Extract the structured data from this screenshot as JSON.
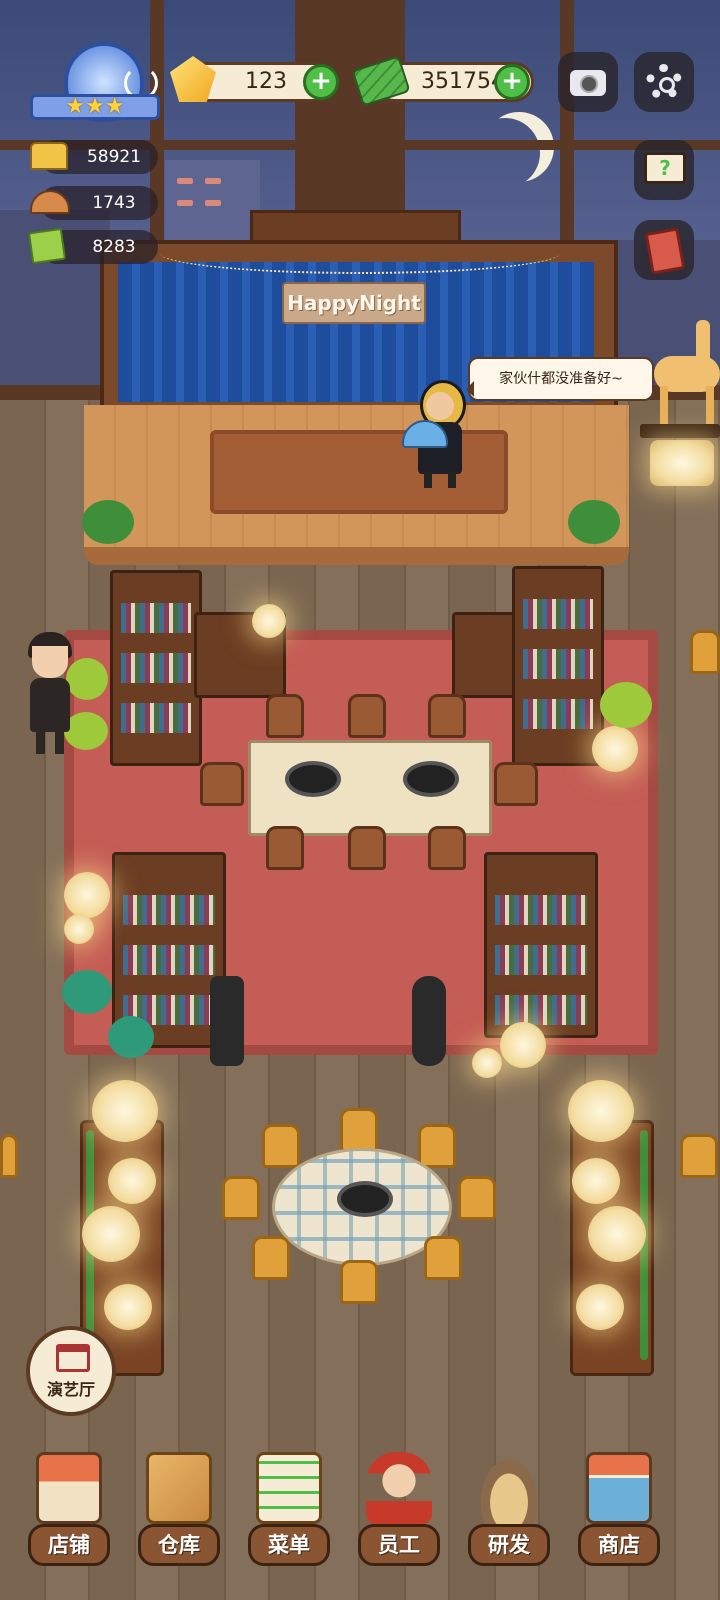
{
  "hud": {
    "gems": "123",
    "cash": "351754",
    "seats": "58921",
    "dishes": "1743",
    "recipes": "8283",
    "level_stars": "★★★"
  },
  "scene": {
    "stage_sign": "HappyNight",
    "speech_bubble": "家伙什都没准备好~",
    "theater_button_label": "演艺厅"
  },
  "bottom_nav": {
    "items": [
      {
        "label": "店铺",
        "icon": "shop-icon"
      },
      {
        "label": "仓库",
        "icon": "storage-icon"
      },
      {
        "label": "菜单",
        "icon": "menu-icon"
      },
      {
        "label": "员工",
        "icon": "staff-icon"
      },
      {
        "label": "研发",
        "icon": "research-icon"
      },
      {
        "label": "商店",
        "icon": "store-icon"
      }
    ]
  },
  "colors": {
    "panel_brown": "#8a5532",
    "plus_green": "#4fbf47",
    "carpet_red": "#c45d55"
  }
}
